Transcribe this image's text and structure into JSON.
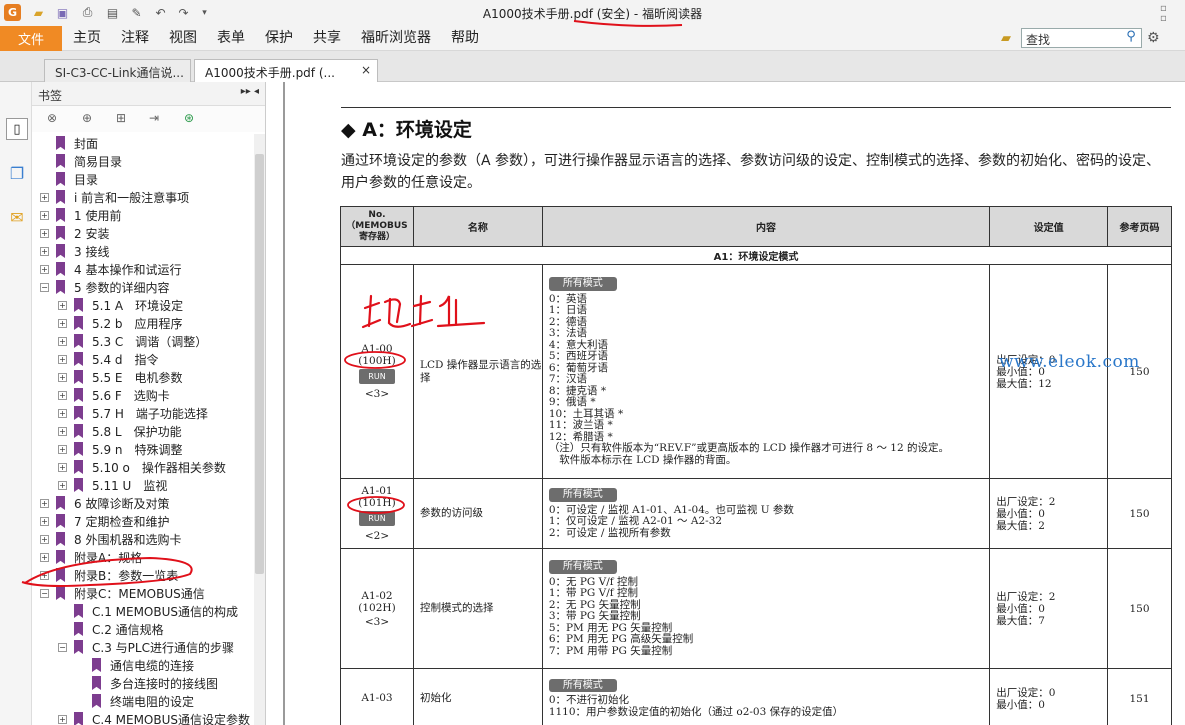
{
  "window": {
    "title": "A1000技术手册.pdf (安全) - 福昕阅读器"
  },
  "ribbon": {
    "file_tab": "文件",
    "menu": [
      "主页",
      "注释",
      "视图",
      "表单",
      "保护",
      "共享",
      "福昕浏览器",
      "帮助"
    ],
    "search_value": "查找"
  },
  "tabs": [
    {
      "label": "SI-C3-CC-Link通信说..."
    },
    {
      "label": "A1000技术手册.pdf (...",
      "close": "×"
    }
  ],
  "bookmarks": {
    "title": "书签",
    "items": [
      {
        "label": "封面",
        "expand": ""
      },
      {
        "label": "简易目录",
        "expand": ""
      },
      {
        "label": "目录",
        "expand": ""
      },
      {
        "label": "i 前言和一般注意事项",
        "expand": "+"
      },
      {
        "label": "1 使用前",
        "expand": "+"
      },
      {
        "label": "2 安装",
        "expand": "+"
      },
      {
        "label": "3 接线",
        "expand": "+"
      },
      {
        "label": "4 基本操作和试运行",
        "expand": "+"
      },
      {
        "label": "5 参数的详细内容",
        "expand": "−"
      },
      {
        "label": "5.1 A　环境设定",
        "expand": "+"
      },
      {
        "label": "5.2 b　应用程序",
        "expand": "+"
      },
      {
        "label": "5.3 C　调谐（调整）",
        "expand": "+"
      },
      {
        "label": "5.4 d　指令",
        "expand": "+"
      },
      {
        "label": "5.5 E　电机参数",
        "expand": "+"
      },
      {
        "label": "5.6 F　选购卡",
        "expand": "+"
      },
      {
        "label": "5.7 H　端子功能选择",
        "expand": "+"
      },
      {
        "label": "5.8 L　保护功能",
        "expand": "+"
      },
      {
        "label": "5.9 n　特殊调整",
        "expand": "+"
      },
      {
        "label": "5.10 o　操作器相关参数",
        "expand": "+"
      },
      {
        "label": "5.11 U　监视",
        "expand": "+"
      },
      {
        "label": "6 故障诊断及对策",
        "expand": "+"
      },
      {
        "label": "7 定期检查和维护",
        "expand": "+"
      },
      {
        "label": "8 外围机器和选购卡",
        "expand": "+"
      },
      {
        "label": "附录A：规格",
        "expand": "+"
      },
      {
        "label": "附录B：参数一览表",
        "expand": "+"
      },
      {
        "label": "附录C：MEMOBUS通信",
        "expand": "−"
      },
      {
        "label": "C.1 MEMOBUS通信的构成",
        "expand": ""
      },
      {
        "label": "C.2 通信规格",
        "expand": ""
      },
      {
        "label": "C.3 与PLC进行通信的步骤",
        "expand": "−"
      },
      {
        "label": "通信电缆的连接",
        "expand": ""
      },
      {
        "label": "多台连接时的接线图",
        "expand": ""
      },
      {
        "label": "终端电阻的设定",
        "expand": ""
      },
      {
        "label": "C.4 MEMOBUS通信设定参数",
        "expand": "+"
      }
    ]
  },
  "document": {
    "section_title": "◆ A：环境设定",
    "section_desc": "通过环境设定的参数（A 参数），可进行操作器显示语言的选择、参数访问级的设定、控制模式的选择、参数的初始化、密码的设定、用户参数的任意设定。",
    "table": {
      "headers": [
        "No.（MEMOBUS寄存器）",
        "名称",
        "内容",
        "设定值",
        "参考页码"
      ],
      "subheader": "A1：环境设定模式",
      "rows": [
        {
          "no": "A1-00",
          "reg": "(100H)",
          "run": "RUN",
          "note": "<3>",
          "name": "LCD 操作器显示语言的选择",
          "mode": "所有模式",
          "options": [
            "0：英语",
            "1：日语",
            "2：德语",
            "3：法语",
            "4：意大利语",
            "5：西班牙语",
            "6：葡萄牙语",
            "7：汉语",
            "8：捷克语 *",
            "9：俄语 *",
            "10：土耳其语 *",
            "11：波兰语 *",
            "12：希腊语 *",
            "（注）只有软件版本为“REV.F”或更高版本的 LCD 操作器才可进行 8 ～ 12 的设定。",
            "　软件版本标示在 LCD 操作器的背面。"
          ],
          "setting": [
            "出厂设定：0",
            "最小值：0",
            "最大值：12"
          ],
          "page": "150"
        },
        {
          "no": "A1-01",
          "reg": "(101H)",
          "run": "RUN",
          "note": "<2>",
          "name": "参数的访问级",
          "mode": "所有模式",
          "options": [
            "0：可设定 / 监视 A1-01、A1-04。也可监视 U 参数",
            "1：仅可设定 / 监视 A2-01 ～ A2-32",
            "2：可设定 / 监视所有参数"
          ],
          "setting": [
            "出厂设定：2",
            "最小值：0",
            "最大值：2"
          ],
          "page": "150"
        },
        {
          "no": "A1-02",
          "reg": "(102H)",
          "run": "",
          "note": "<3>",
          "name": "控制模式的选择",
          "mode": "所有模式",
          "options": [
            "0：无 PG V/f 控制",
            "1：带 PG V/f 控制",
            "2：无 PG 矢量控制",
            "3：带 PG 矢量控制",
            "5：PM 用无 PG 矢量控制",
            "6：PM 用无 PG 高级矢量控制",
            "7：PM 用带 PG 矢量控制"
          ],
          "setting": [
            "出厂设定：2",
            "最小值：0",
            "最大值：7"
          ],
          "page": "150"
        },
        {
          "no": "A1-03",
          "reg": "",
          "run": "",
          "note": "",
          "name": "初始化",
          "mode": "所有模式",
          "options": [
            "0：不进行初始化",
            "1110：用户参数设定值的初始化（通过 o2-03 保存的设定值）"
          ],
          "setting": [
            "出厂设定：0",
            "最小值：0"
          ],
          "page": "151"
        }
      ]
    },
    "watermark": "www.eleok.com",
    "handwriting": "地址"
  },
  "colors": {
    "file_tab": "#f08a24",
    "bookmark_icon": "#7d3d8f",
    "annotation_red": "#e0101a",
    "watermark": "#2a77c9"
  }
}
